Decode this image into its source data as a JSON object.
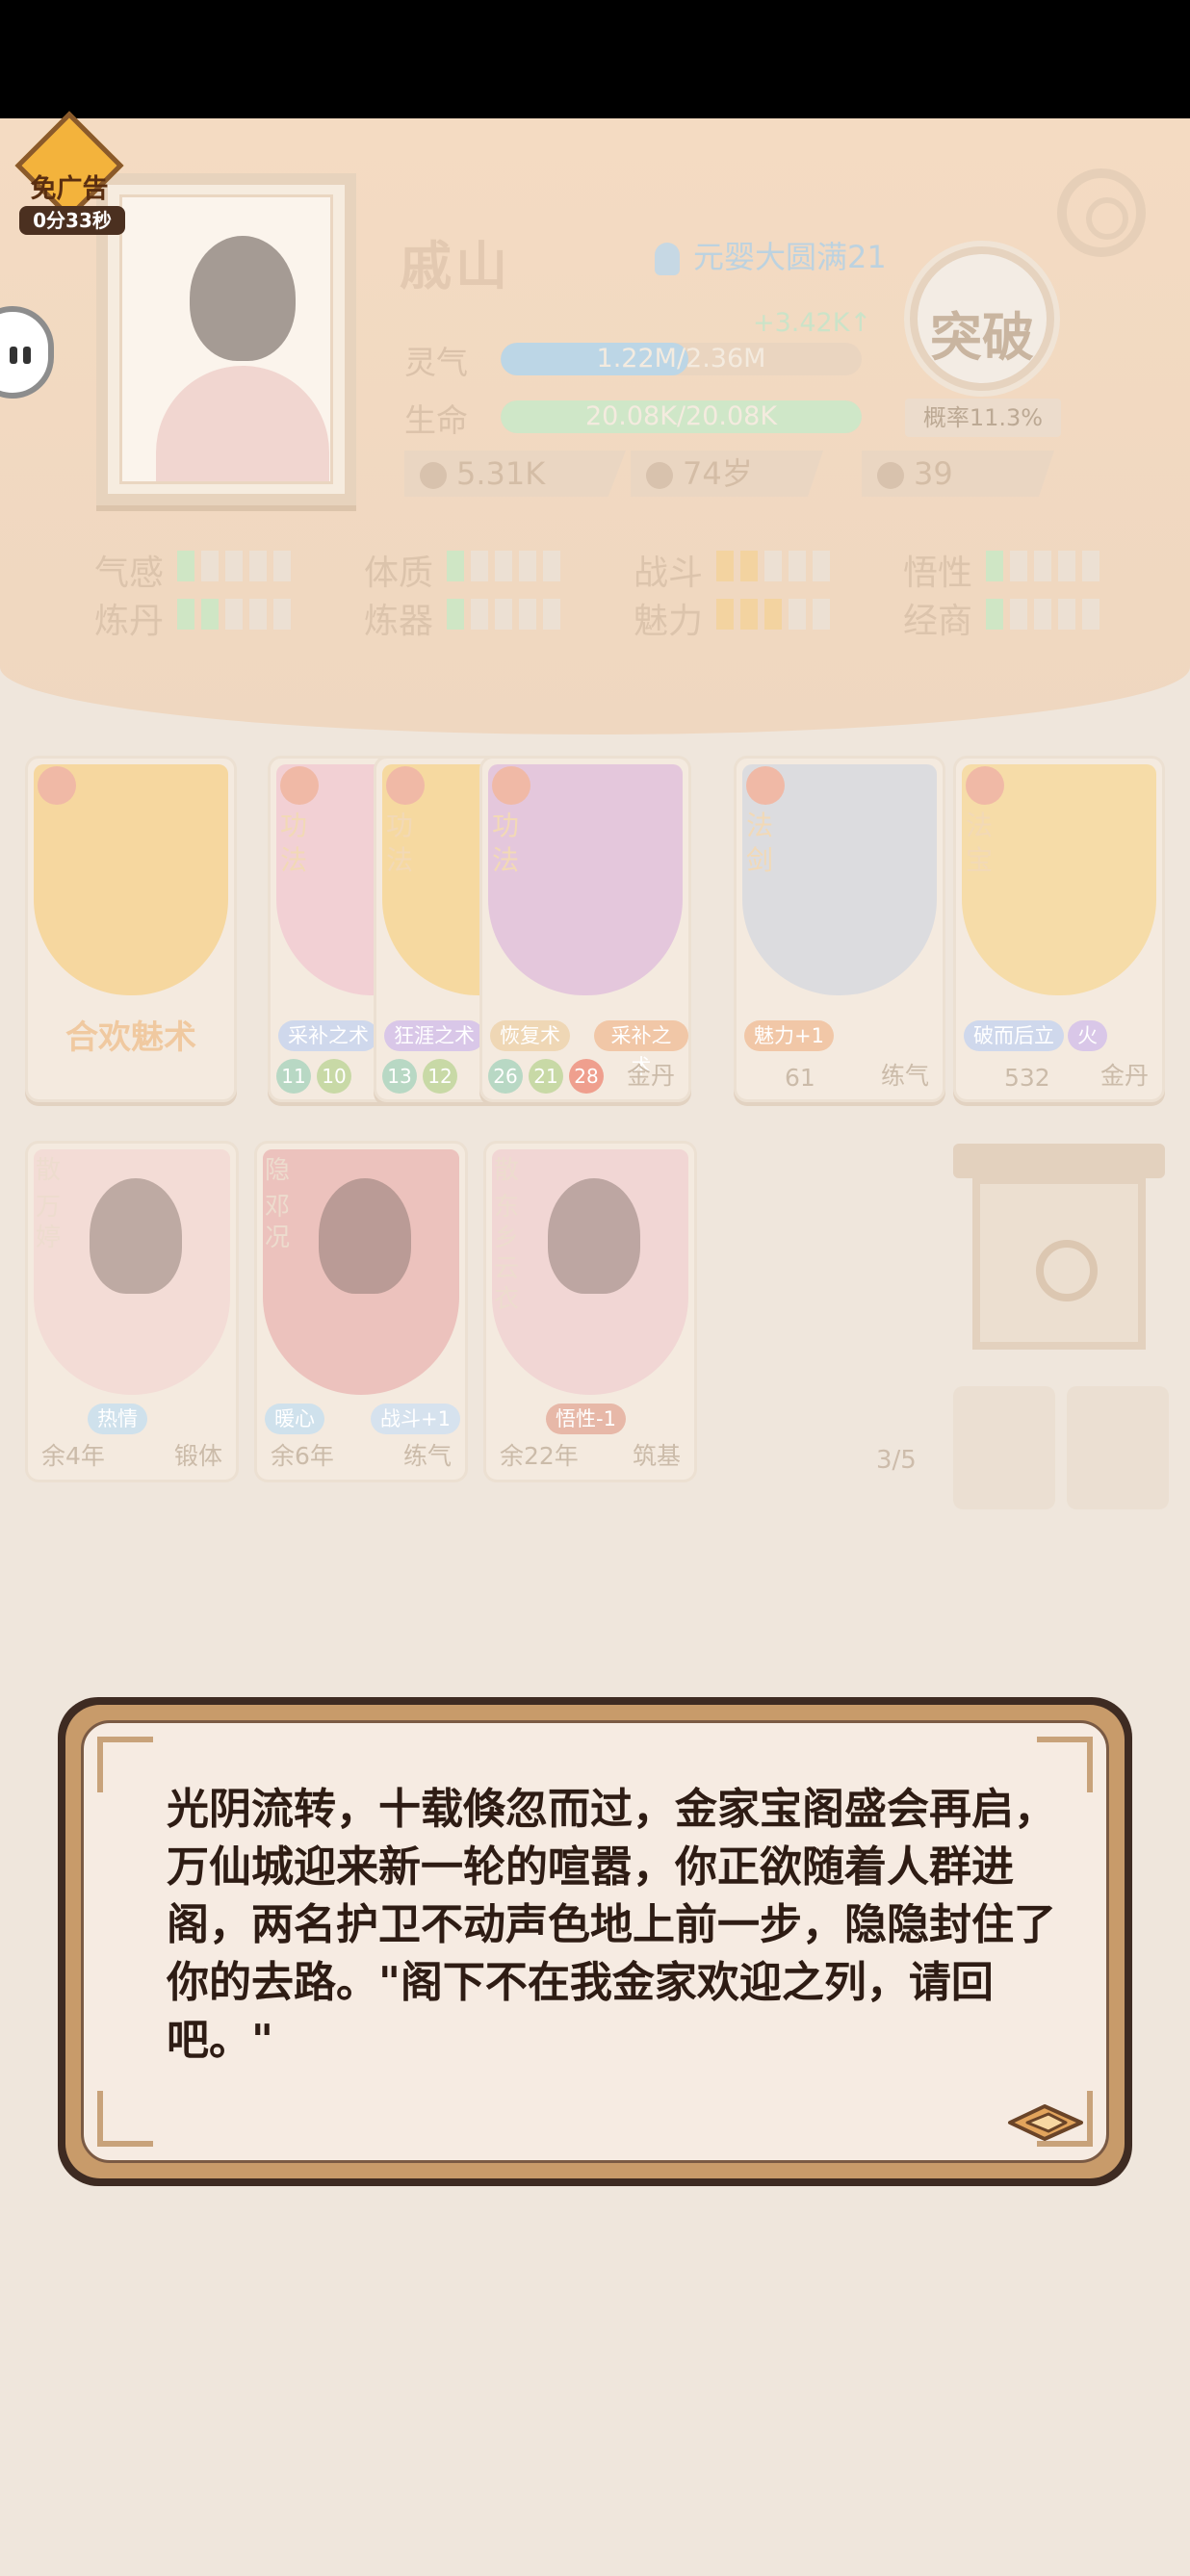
{
  "ad": {
    "label": "免广告",
    "timer": "0分33秒"
  },
  "character": {
    "name": "戚山",
    "realm": "元婴大圆满21",
    "qi_gain": "+3.42K↑",
    "breakthrough": "突破",
    "rate": "概率11.3%",
    "qi_label": "灵气",
    "qi_value": "1.22M/2.36M",
    "qi_fraction": 0.52,
    "hp_label": "生命",
    "hp_value": "20.08K/20.08K",
    "hp_fraction": 1.0,
    "combat_power": "5.31K",
    "age": "74岁",
    "kills": "39"
  },
  "attributes": [
    {
      "label": "气感",
      "level": 1,
      "color": "#cfe6c5"
    },
    {
      "label": "体质",
      "level": 1,
      "color": "#cfe6c5"
    },
    {
      "label": "战斗",
      "level": 2,
      "color": "#f3d3a0"
    },
    {
      "label": "悟性",
      "level": 1,
      "color": "#cfe6c5"
    },
    {
      "label": "炼丹",
      "level": 2,
      "color": "#cfe6c5"
    },
    {
      "label": "炼器",
      "level": 1,
      "color": "#cfe6c5"
    },
    {
      "label": "魅力",
      "level": 3,
      "color": "#f3d3a0"
    },
    {
      "label": "经商",
      "level": 1,
      "color": "#cfe6c5"
    }
  ],
  "skill_cards": [
    {
      "type": "",
      "title": "合欢魅术",
      "tags": [],
      "nums": [],
      "foot_left": "",
      "foot_right": ""
    },
    {
      "type": "功法",
      "title": "",
      "tags": [
        "采补之术"
      ],
      "nums": [
        "11",
        "10"
      ],
      "foot_left": "",
      "foot_right": ""
    },
    {
      "type": "功法",
      "title": "",
      "tags": [
        "狂涯之术"
      ],
      "nums": [
        "13",
        "12"
      ],
      "foot_left": "",
      "foot_right": ""
    },
    {
      "type": "功法",
      "title": "",
      "tags": [
        "恢复术",
        "采补之术"
      ],
      "nums": [
        "26",
        "21",
        "28"
      ],
      "foot_left": "",
      "foot_right": "金丹"
    },
    {
      "type": "法剑",
      "title": "",
      "tags": [
        "魅力+1"
      ],
      "nums": [],
      "foot_left": "61",
      "foot_right": "练气"
    },
    {
      "type": "法宝",
      "title": "",
      "tags": [
        "破而后立",
        "火"
      ],
      "nums": [],
      "foot_left": "532",
      "foot_right": "金丹"
    }
  ],
  "companions": [
    {
      "type": "散",
      "name": "万婷",
      "tags": [
        "热情"
      ],
      "life": "余4年",
      "realm": "锻体"
    },
    {
      "type": "隐",
      "name": "邓况",
      "tags": [
        "暖心",
        "战斗+1"
      ],
      "life": "余6年",
      "realm": "练气"
    },
    {
      "type": "散",
      "name": "东乡云衣",
      "tags": [
        "悟性-1"
      ],
      "life": "余22年",
      "realm": "筑基"
    }
  ],
  "companion_count": "3/5",
  "dialog": {
    "text": "光阴流转，十载倏忽而过，金家宝阁盛会再启，万仙城迎来新一轮的喧嚣，你正欲随着人群进阁，两名护卫不动声色地上前一步，隐隐封住了你的去路。\"阁下不在我金家欢迎之列，请回吧。\""
  },
  "colors": {
    "qi_bar": "#bcd6e6",
    "hp_bar": "#cfe7c8",
    "dialog_border": "#3e2b22",
    "dialog_bg": "#f6ebe2"
  }
}
